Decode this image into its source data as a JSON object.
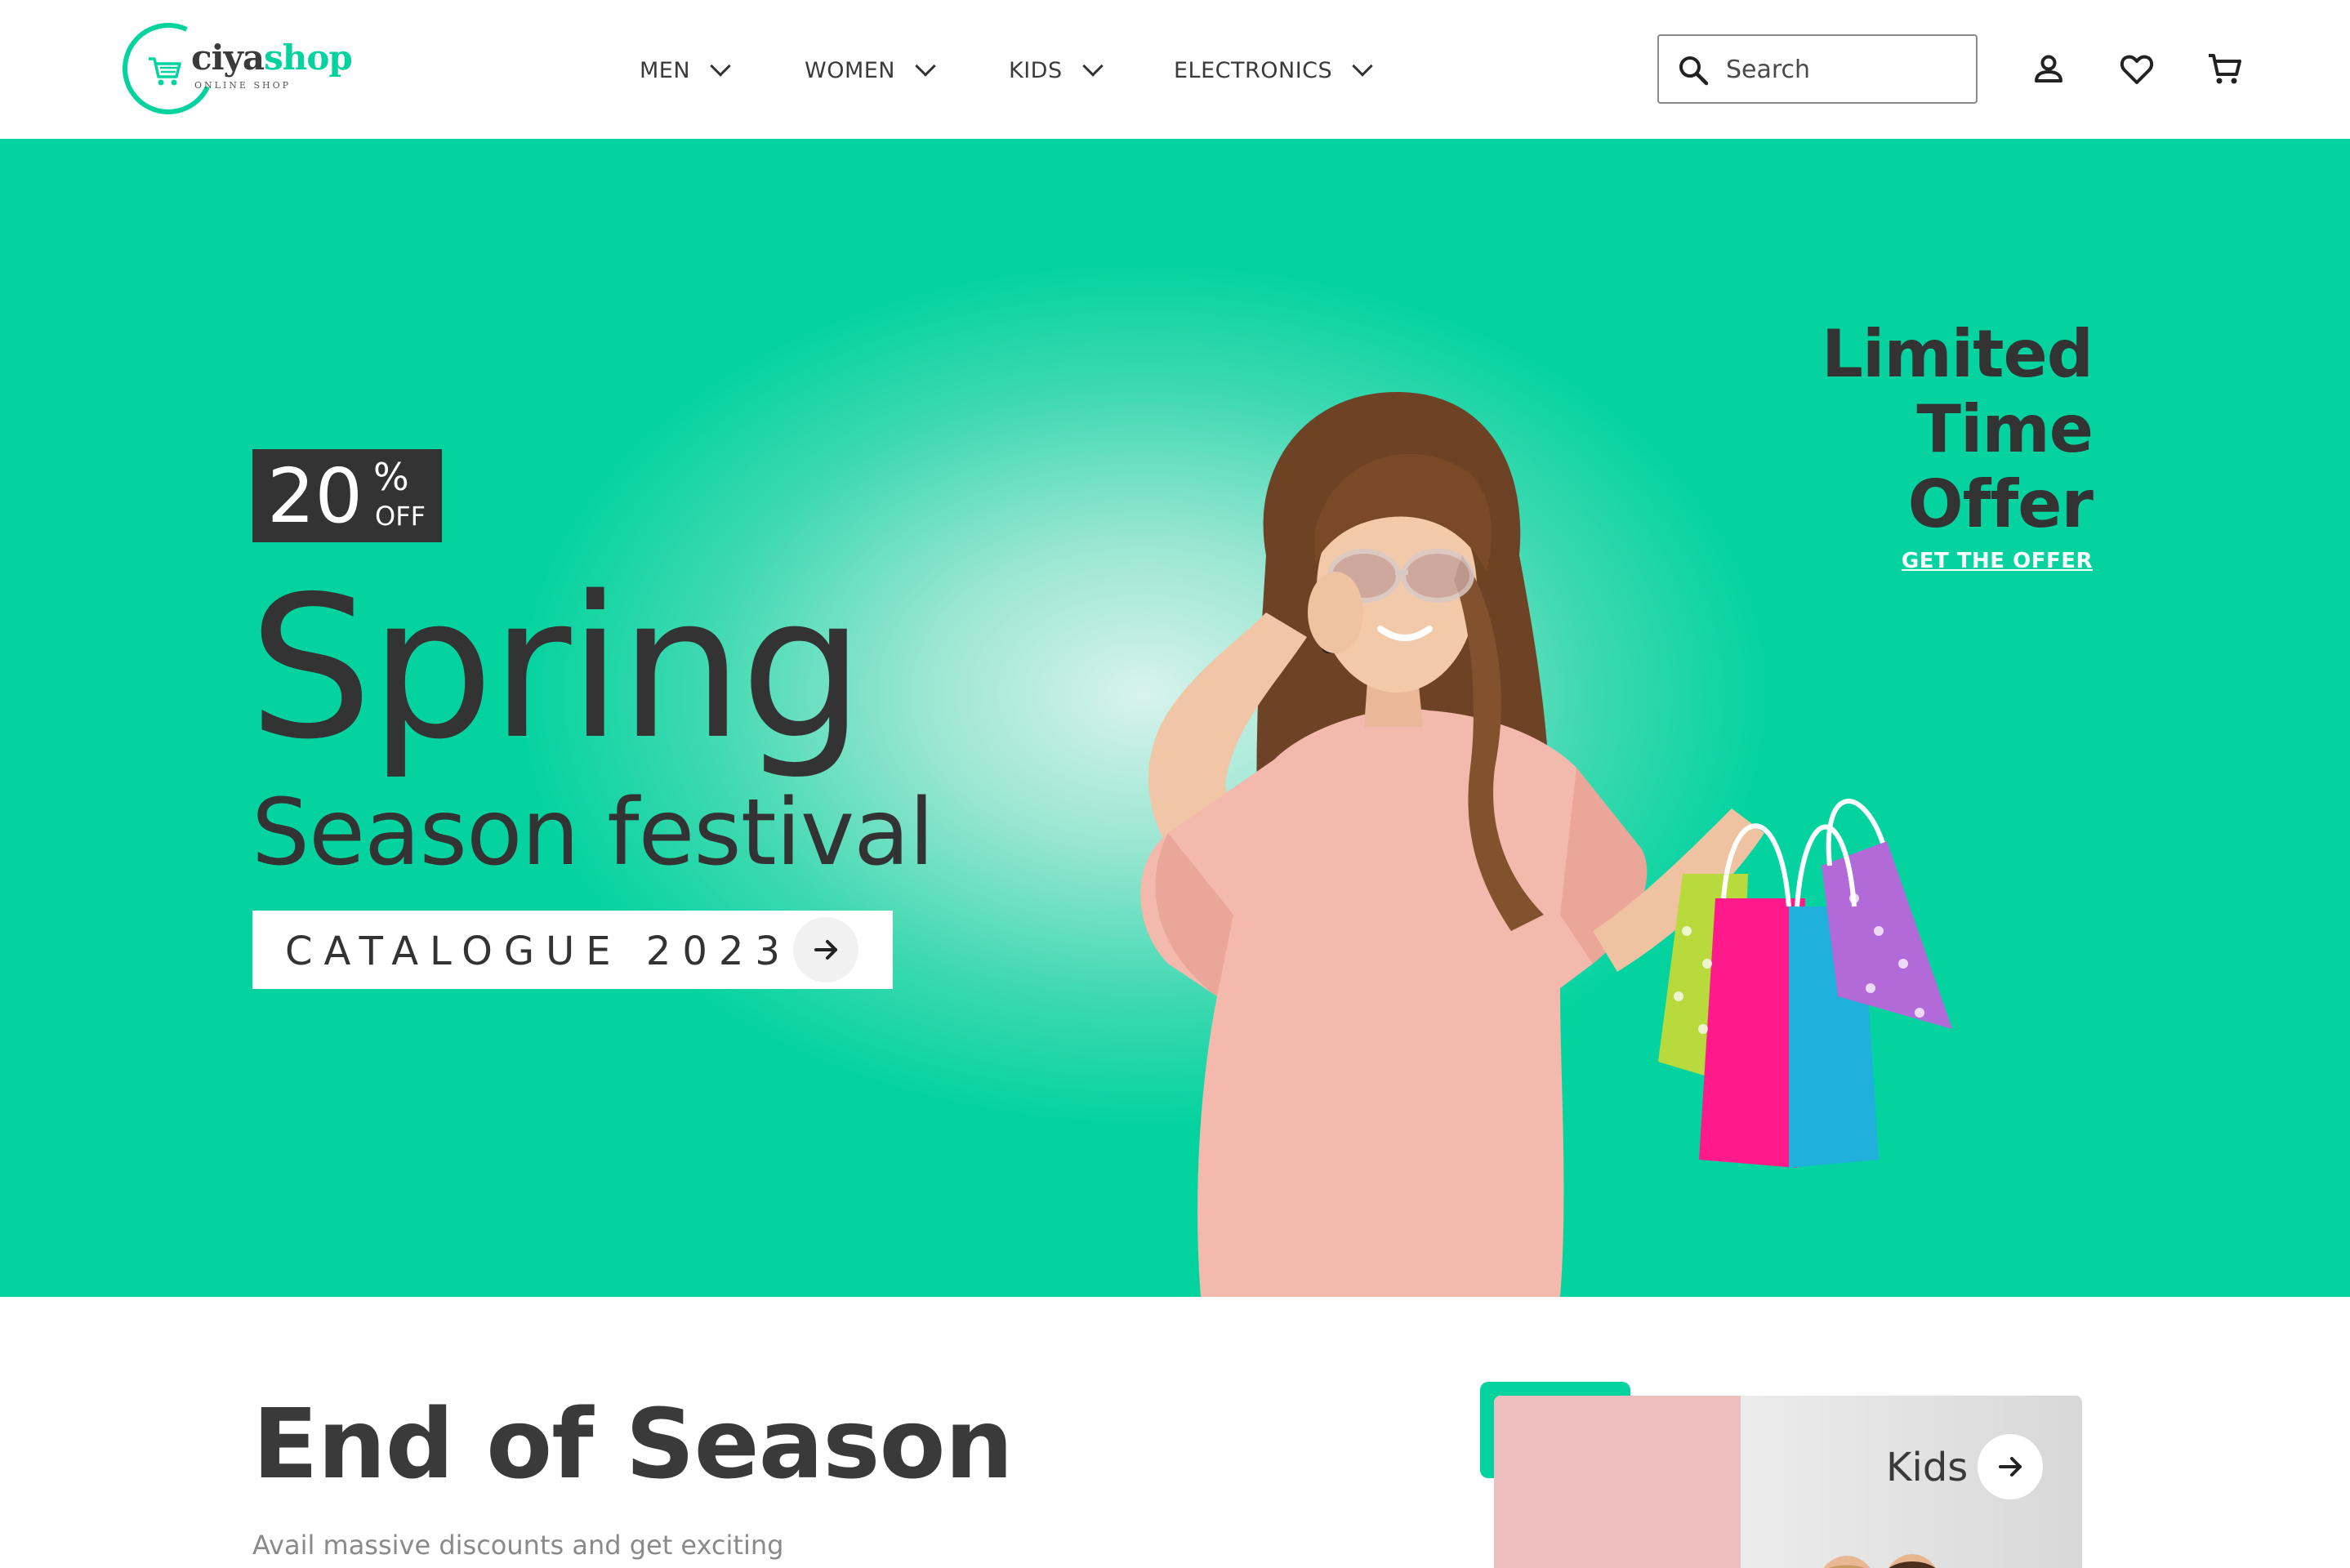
{
  "brand": {
    "name_part1": "ciya",
    "name_part2": "shop",
    "tagline": "ONLINE SHOP",
    "accent_color": "#04d39f",
    "dark_color": "#333333"
  },
  "nav": {
    "items": [
      {
        "label": "MEN",
        "icon": "chevron-down-icon"
      },
      {
        "label": "WOMEN",
        "icon": "chevron-down-icon"
      },
      {
        "label": "KIDS",
        "icon": "chevron-down-icon"
      },
      {
        "label": "ELECTRONICS",
        "icon": "chevron-down-icon"
      }
    ]
  },
  "search": {
    "placeholder": "Search",
    "icon": "search-icon"
  },
  "header_icons": [
    "user-icon",
    "heart-icon",
    "cart-icon"
  ],
  "hero": {
    "discount_number": "20",
    "discount_percent": "%",
    "discount_word": "OFF",
    "headline": "Spring",
    "subheadline": "Season festival",
    "cta_label": "CATALOGUE 2023",
    "cta_icon": "arrow-right-icon",
    "offer_line1": "Limited",
    "offer_line2": "Time",
    "offer_line3": "Offer",
    "offer_link": "GET THE OFFER"
  },
  "section": {
    "title": "End of Season",
    "subtitle": "Avail massive discounts and get exciting"
  },
  "category_card": {
    "label": "Kids",
    "icon": "arrow-right-icon"
  }
}
